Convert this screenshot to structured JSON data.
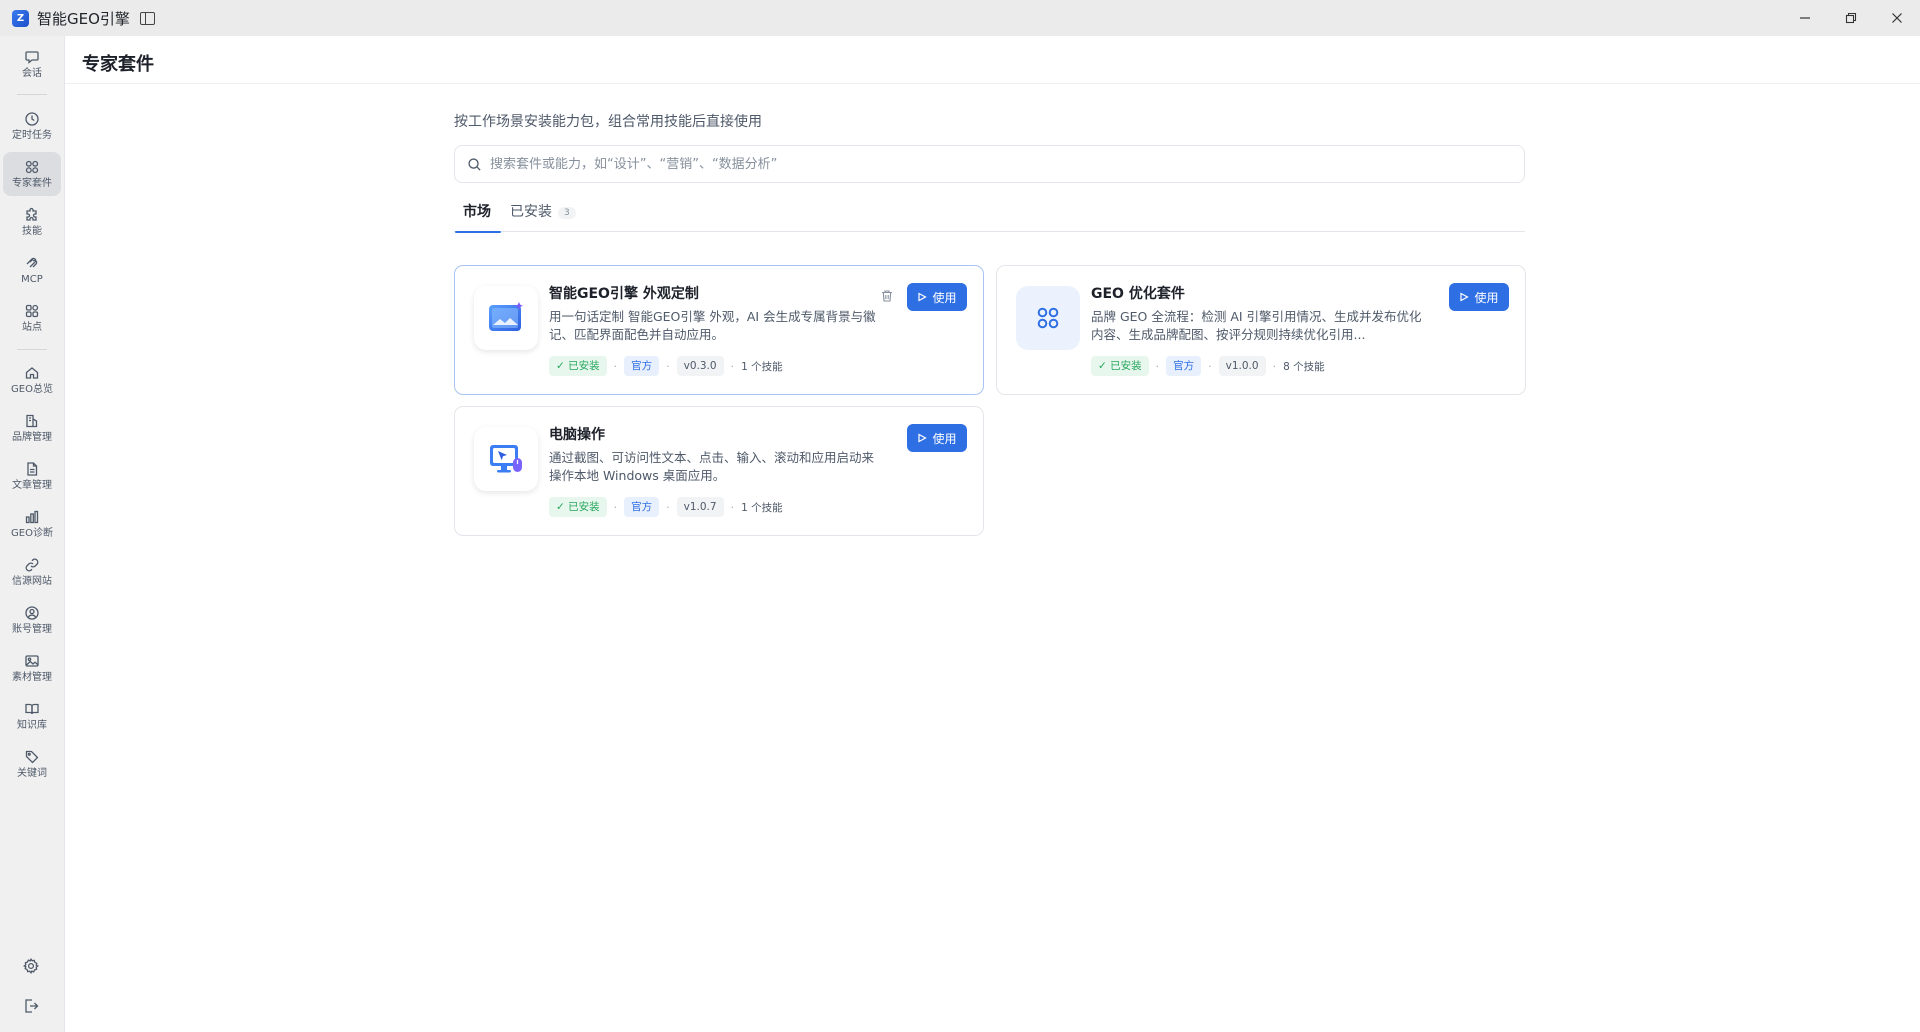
{
  "app": {
    "title": "智能GEO引擎",
    "logo_text": "Z"
  },
  "window_controls": [
    "minimize-icon",
    "restore-icon",
    "close-icon"
  ],
  "sidebar": {
    "items": [
      {
        "label": "会话",
        "icon": "chat-icon"
      },
      {
        "label": "定时任务",
        "icon": "clock-icon"
      },
      {
        "label": "专家套件",
        "icon": "grid-icon",
        "active": true
      },
      {
        "label": "技能",
        "icon": "puzzle-icon"
      },
      {
        "label": "MCP",
        "icon": "mcp-icon"
      },
      {
        "label": "站点",
        "icon": "apps-icon"
      },
      {
        "label": "GEO总览",
        "icon": "home-icon"
      },
      {
        "label": "品牌管理",
        "icon": "brand-icon"
      },
      {
        "label": "文章管理",
        "icon": "document-icon"
      },
      {
        "label": "GEO诊断",
        "icon": "bar-chart-icon"
      },
      {
        "label": "信源网站",
        "icon": "link-icon"
      },
      {
        "label": "账号管理",
        "icon": "user-icon"
      },
      {
        "label": "素材管理",
        "icon": "image-icon"
      },
      {
        "label": "知识库",
        "icon": "book-icon"
      },
      {
        "label": "关键词",
        "icon": "tag-icon"
      }
    ],
    "bottom": [
      "settings-icon",
      "logout-icon"
    ]
  },
  "page": {
    "title": "专家套件",
    "subtitle": "按工作场景安装能力包，组合常用技能后直接使用"
  },
  "search": {
    "placeholder": "搜索套件或能力，如“设计”、“营销”、“数据分析”",
    "value": ""
  },
  "tabs": [
    {
      "label": "市场",
      "active": true
    },
    {
      "label": "已安装",
      "count": "3"
    }
  ],
  "cards": [
    {
      "title": "智能GEO引擎 外观定制",
      "description": "用一句话定制 智能GEO引擎 外观，AI 会生成专属背景与徽记、匹配界面配色并自动应用。",
      "status": "已安装",
      "source": "官方",
      "version": "v0.3.0",
      "skills": "1 个技能",
      "action": "使用",
      "icon": "theme-window-icon"
    },
    {
      "title": "GEO 优化套件",
      "description": "品牌 GEO 全流程：检测 AI 引擎引用情况、生成并发布优化内容、生成品牌配图、按评分规则持续优化引用...",
      "status": "已安装",
      "source": "官方",
      "version": "v1.0.0",
      "skills": "8 个技能",
      "action": "使用",
      "icon": "four-circles-icon"
    },
    {
      "title": "电脑操作",
      "description": "通过截图、可访问性文本、点击、输入、滚动和应用启动来操作本地 Windows 桌面应用。",
      "status": "已安装",
      "source": "官方",
      "version": "v1.0.7",
      "skills": "1 个技能",
      "action": "使用",
      "icon": "computer-cursor-icon"
    }
  ],
  "colors": {
    "accent": "#2f6fe4",
    "installed_green": "#23a55a",
    "sidebar_bg": "#f0f0f0",
    "titlebar_bg": "#ebebeb"
  }
}
